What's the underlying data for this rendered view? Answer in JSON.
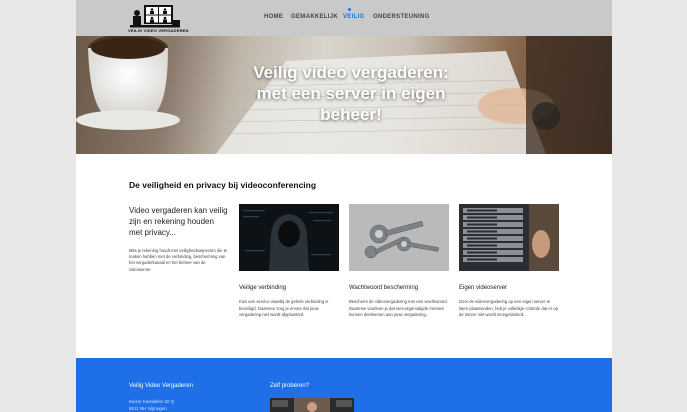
{
  "logo": {
    "text": "Veilig video vergaderen"
  },
  "nav": {
    "items": [
      {
        "label": "HOME"
      },
      {
        "label": "GEMAKKELIJK"
      },
      {
        "label": "VEILIG"
      },
      {
        "label": "ONDERSTEUNING"
      }
    ],
    "active": "VEILIG"
  },
  "hero": {
    "title_line1": "Veilig video vergaderen:",
    "title_line2": "met een server in eigen",
    "title_line3": "beheer!"
  },
  "section": {
    "title": "De veiligheid en privacy bij videoconferencing",
    "intro_head": "Video vergaderen kan veilig zijn en rekening houden met privacy...",
    "intro_body": "Mits je rekening houdt met veiligheidsaspecten die te maken hebben met de verbinding, bescherming van het vergaderkanaal en het beheer van de videoserver."
  },
  "cards": [
    {
      "title": "Veilige verbinding",
      "body": "Kies een service waarbij de gehele verbinding is beveiligd. Daarmee zorg je ervoor dat jouw vergadering niet wordt afgeluisterd."
    },
    {
      "title": "Wachtwoord bescherming",
      "body": "Bescherm de videovergadering met een wachtwoord. Daarmee voorkom je dat niet-uitgenodigde mensen kunnen deelnemen aan jouw vergadering."
    },
    {
      "title": "Eigen videoserver",
      "body": "Door de videovergadering op een eigen server te laten plaatsvinden, heb je volledige controle dat er op de server niet wordt meegeluisterd."
    }
  ],
  "footer": {
    "col1_title": "Veilig Video Vergaderen",
    "col2_title": "Zelf proberen?",
    "address_line1": "Keizer Karelplein 32 Q",
    "address_line2": "6511 NH Nijmegen"
  },
  "colors": {
    "accent": "#1a73e8",
    "footer": "#1e6fe8",
    "header": "#c9c9c9"
  }
}
